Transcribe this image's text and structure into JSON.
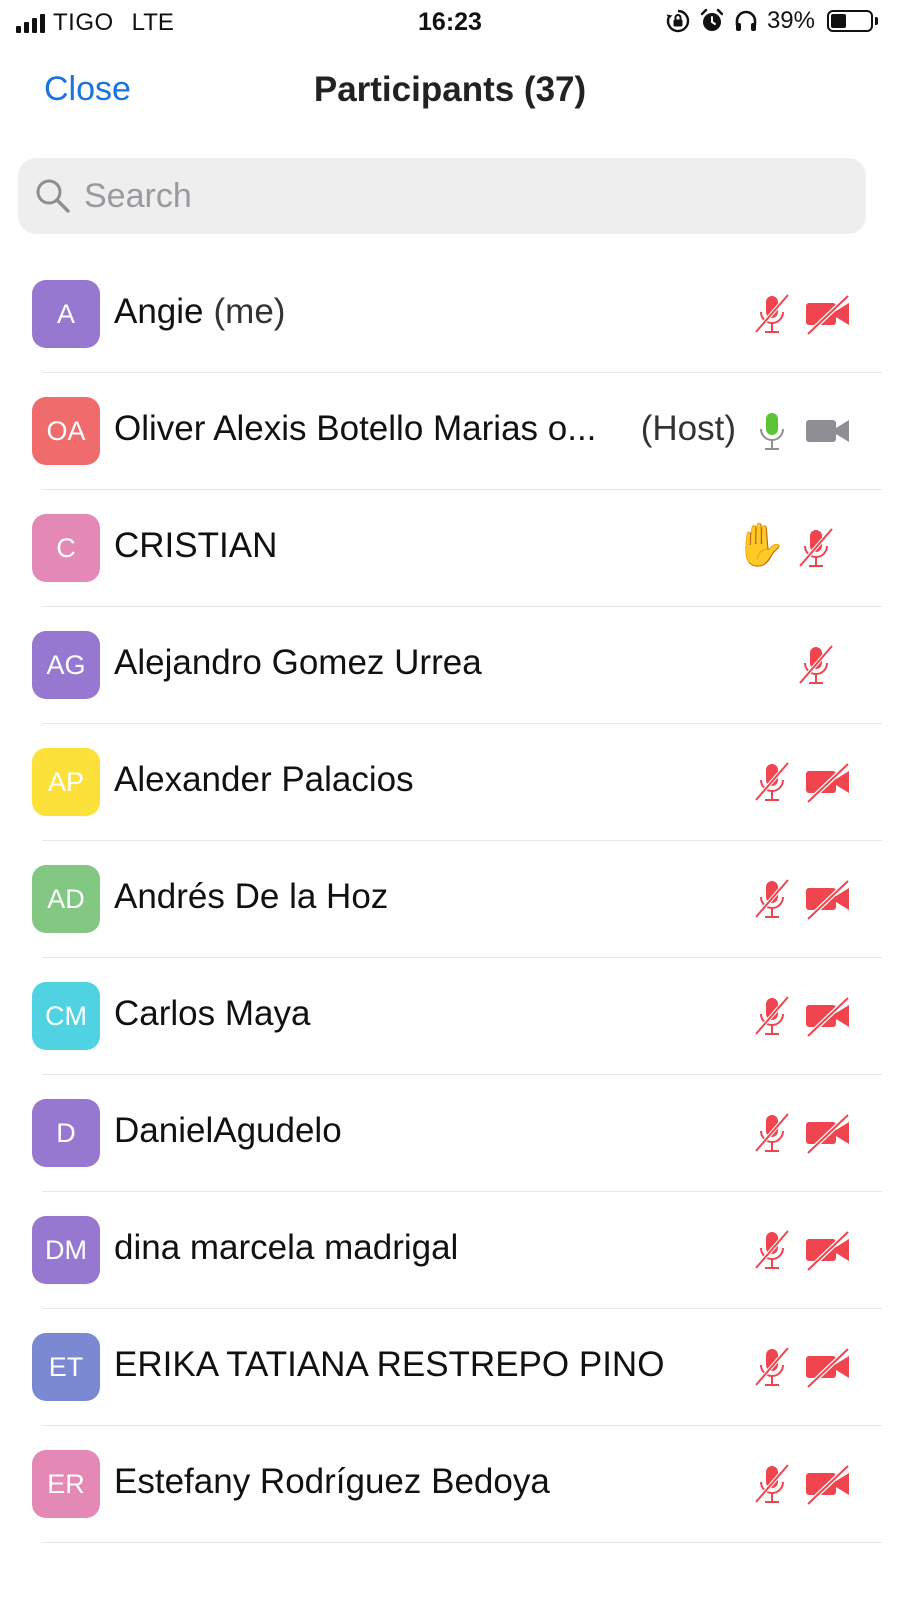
{
  "status_bar": {
    "carrier": "TIGO",
    "network": "LTE",
    "time": "16:23",
    "battery_percent": "39%",
    "battery_level": 0.39,
    "icons": [
      "rotation-lock-icon",
      "alarm-icon",
      "headphones-icon"
    ]
  },
  "header": {
    "close_label": "Close",
    "title": "Participants (37)"
  },
  "search": {
    "placeholder": "Search",
    "value": ""
  },
  "colors": {
    "accent": "#1a73e0",
    "muted_red": "#f0444e",
    "unmuted_green": "#5cc335",
    "video_on_gray": "#8e8e93"
  },
  "participants": [
    {
      "initials": "A",
      "avatar_color": "#9778d1",
      "name": "Angie",
      "suffix": "(me)",
      "role": "",
      "hand_raised": false,
      "mic": "muted",
      "video": "off"
    },
    {
      "initials": "OA",
      "avatar_color": "#f06b6b",
      "name": "Oliver Alexis Botello Marias o...",
      "suffix": "",
      "role": "(Host)",
      "hand_raised": false,
      "mic": "on",
      "video": "on"
    },
    {
      "initials": "C",
      "avatar_color": "#e488b6",
      "name": "CRISTIAN",
      "suffix": "",
      "role": "",
      "hand_raised": true,
      "hand_emoji": "✋",
      "mic": "muted",
      "video": "none"
    },
    {
      "initials": "AG",
      "avatar_color": "#9778d1",
      "name": "Alejandro Gomez Urrea",
      "suffix": "",
      "role": "",
      "hand_raised": false,
      "mic": "muted",
      "video": "none"
    },
    {
      "initials": "AP",
      "avatar_color": "#fbe13a",
      "name": "Alexander Palacios",
      "suffix": "",
      "role": "",
      "hand_raised": false,
      "mic": "muted",
      "video": "off"
    },
    {
      "initials": "AD",
      "avatar_color": "#82c882",
      "name": "Andrés De la Hoz",
      "suffix": "",
      "role": "",
      "hand_raised": false,
      "mic": "muted",
      "video": "off"
    },
    {
      "initials": "CM",
      "avatar_color": "#4fd2e2",
      "name": "Carlos Maya",
      "suffix": "",
      "role": "",
      "hand_raised": false,
      "mic": "muted",
      "video": "off"
    },
    {
      "initials": "D",
      "avatar_color": "#9778d1",
      "name": "DanielAgudelo",
      "suffix": "",
      "role": "",
      "hand_raised": false,
      "mic": "muted",
      "video": "off"
    },
    {
      "initials": "DM",
      "avatar_color": "#9778d1",
      "name": "dina marcela madrigal",
      "suffix": "",
      "role": "",
      "hand_raised": false,
      "mic": "muted",
      "video": "off"
    },
    {
      "initials": "ET",
      "avatar_color": "#7a89d2",
      "name": "ERIKA TATIANA RESTREPO PINO",
      "suffix": "",
      "role": "",
      "hand_raised": false,
      "mic": "muted",
      "video": "off"
    },
    {
      "initials": "ER",
      "avatar_color": "#e488b6",
      "name": "Estefany Rodríguez Bedoya",
      "suffix": "",
      "role": "",
      "hand_raised": false,
      "mic": "muted",
      "video": "off"
    }
  ]
}
